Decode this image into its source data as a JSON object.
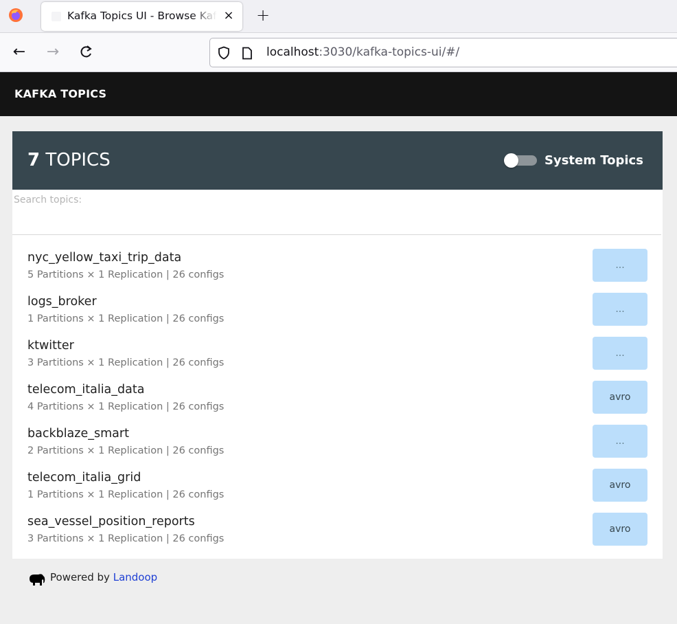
{
  "browser": {
    "tab_title": "Kafka Topics UI - Browse Kafka Topics",
    "tab_close": "×",
    "new_tab": "+",
    "url_host": "localhost",
    "url_rest": ":3030/kafka-topics-ui/#/"
  },
  "app": {
    "title": "KAFKA TOPICS"
  },
  "panel": {
    "count": "7",
    "count_label": "TOPICS",
    "system_topics_label": "System Topics",
    "system_topics_enabled": false
  },
  "search": {
    "label": "Search topics:",
    "value": ""
  },
  "topics": [
    {
      "name": "nyc_yellow_taxi_trip_data",
      "meta": "5 Partitions × 1 Replication | 26 configs",
      "badge": "..."
    },
    {
      "name": "logs_broker",
      "meta": "1 Partitions × 1 Replication | 26 configs",
      "badge": "..."
    },
    {
      "name": "ktwitter",
      "meta": "3 Partitions × 1 Replication | 26 configs",
      "badge": "..."
    },
    {
      "name": "telecom_italia_data",
      "meta": "4 Partitions × 1 Replication | 26 configs",
      "badge": "avro"
    },
    {
      "name": "backblaze_smart",
      "meta": "2 Partitions × 1 Replication | 26 configs",
      "badge": "..."
    },
    {
      "name": "telecom_italia_grid",
      "meta": "1 Partitions × 1 Replication | 26 configs",
      "badge": "avro"
    },
    {
      "name": "sea_vessel_position_reports",
      "meta": "3 Partitions × 1 Replication | 26 configs",
      "badge": "avro"
    }
  ],
  "footer": {
    "powered_by": "Powered by",
    "link": "Landoop"
  },
  "colors": {
    "header_bg": "#141414",
    "panel_head_bg": "#37474f",
    "badge_bg": "#bbdefb",
    "link": "#1e3fd4"
  }
}
